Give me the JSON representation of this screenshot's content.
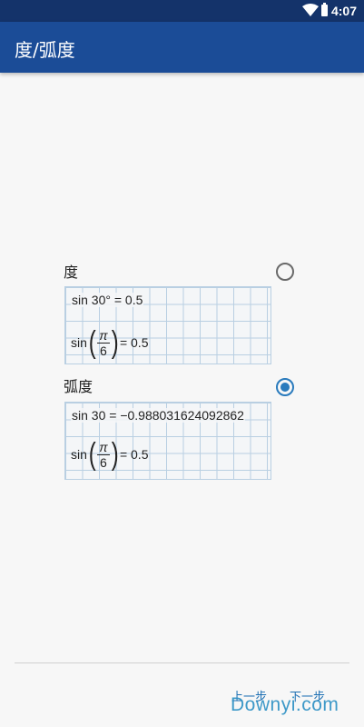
{
  "status_bar": {
    "time": "4:07"
  },
  "app_bar": {
    "title": "度/弧度"
  },
  "options": [
    {
      "label": "度",
      "selected": false,
      "line1": "sin 30° = 0.5",
      "line2_prefix": "sin",
      "frac_num": "π",
      "frac_den": "6",
      "line2_suffix": "= 0.5"
    },
    {
      "label": "弧度",
      "selected": true,
      "line1": "sin 30 = −0.988031624092862",
      "line2_prefix": "sin",
      "frac_num": "π",
      "frac_den": "6",
      "line2_suffix": "= 0.5"
    }
  ],
  "footer": {
    "prev_label": "上一步",
    "next_label": "下一步",
    "watermark": "Downyi.com"
  },
  "colors": {
    "app_bar": "#1b4c97",
    "status_bar": "#14336a",
    "accent": "#2a7bbd"
  }
}
